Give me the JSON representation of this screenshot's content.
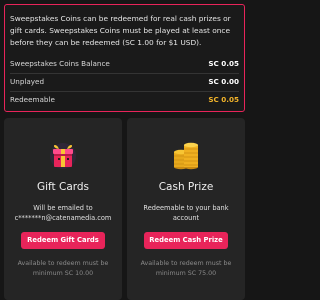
{
  "info": {
    "description": "Sweepstakes Coins can be redeemed for real cash prizes or gift cards. Sweepstakes Coins must be played at least once before they can be redeemed (SC 1.00 for $1 USD).",
    "rows": [
      {
        "label": "Sweepstakes Coins Balance",
        "value": "SC 0.05"
      },
      {
        "label": "Unplayed",
        "value": "SC 0.00"
      },
      {
        "label": "Redeemable",
        "value": "SC 0.05"
      }
    ],
    "accent": "#e8245a",
    "gold": "#f2b32a"
  },
  "cards": [
    {
      "icon": "gift-box-icon",
      "title": "Gift Cards",
      "description_lines": [
        "Will be emailed to",
        "c*******n@catenamedia.com"
      ],
      "button": "Redeem Gift Cards",
      "available_lines": [
        "Available to redeem must be",
        "minimum SC 10.00"
      ]
    },
    {
      "icon": "coin-stack-icon",
      "title": "Cash Prize",
      "description_lines": [
        "Redeemable to your bank account"
      ],
      "button": "Redeem Cash Prize",
      "available_lines": [
        "Available to redeem must be",
        "minimum SC 75.00"
      ]
    }
  ]
}
